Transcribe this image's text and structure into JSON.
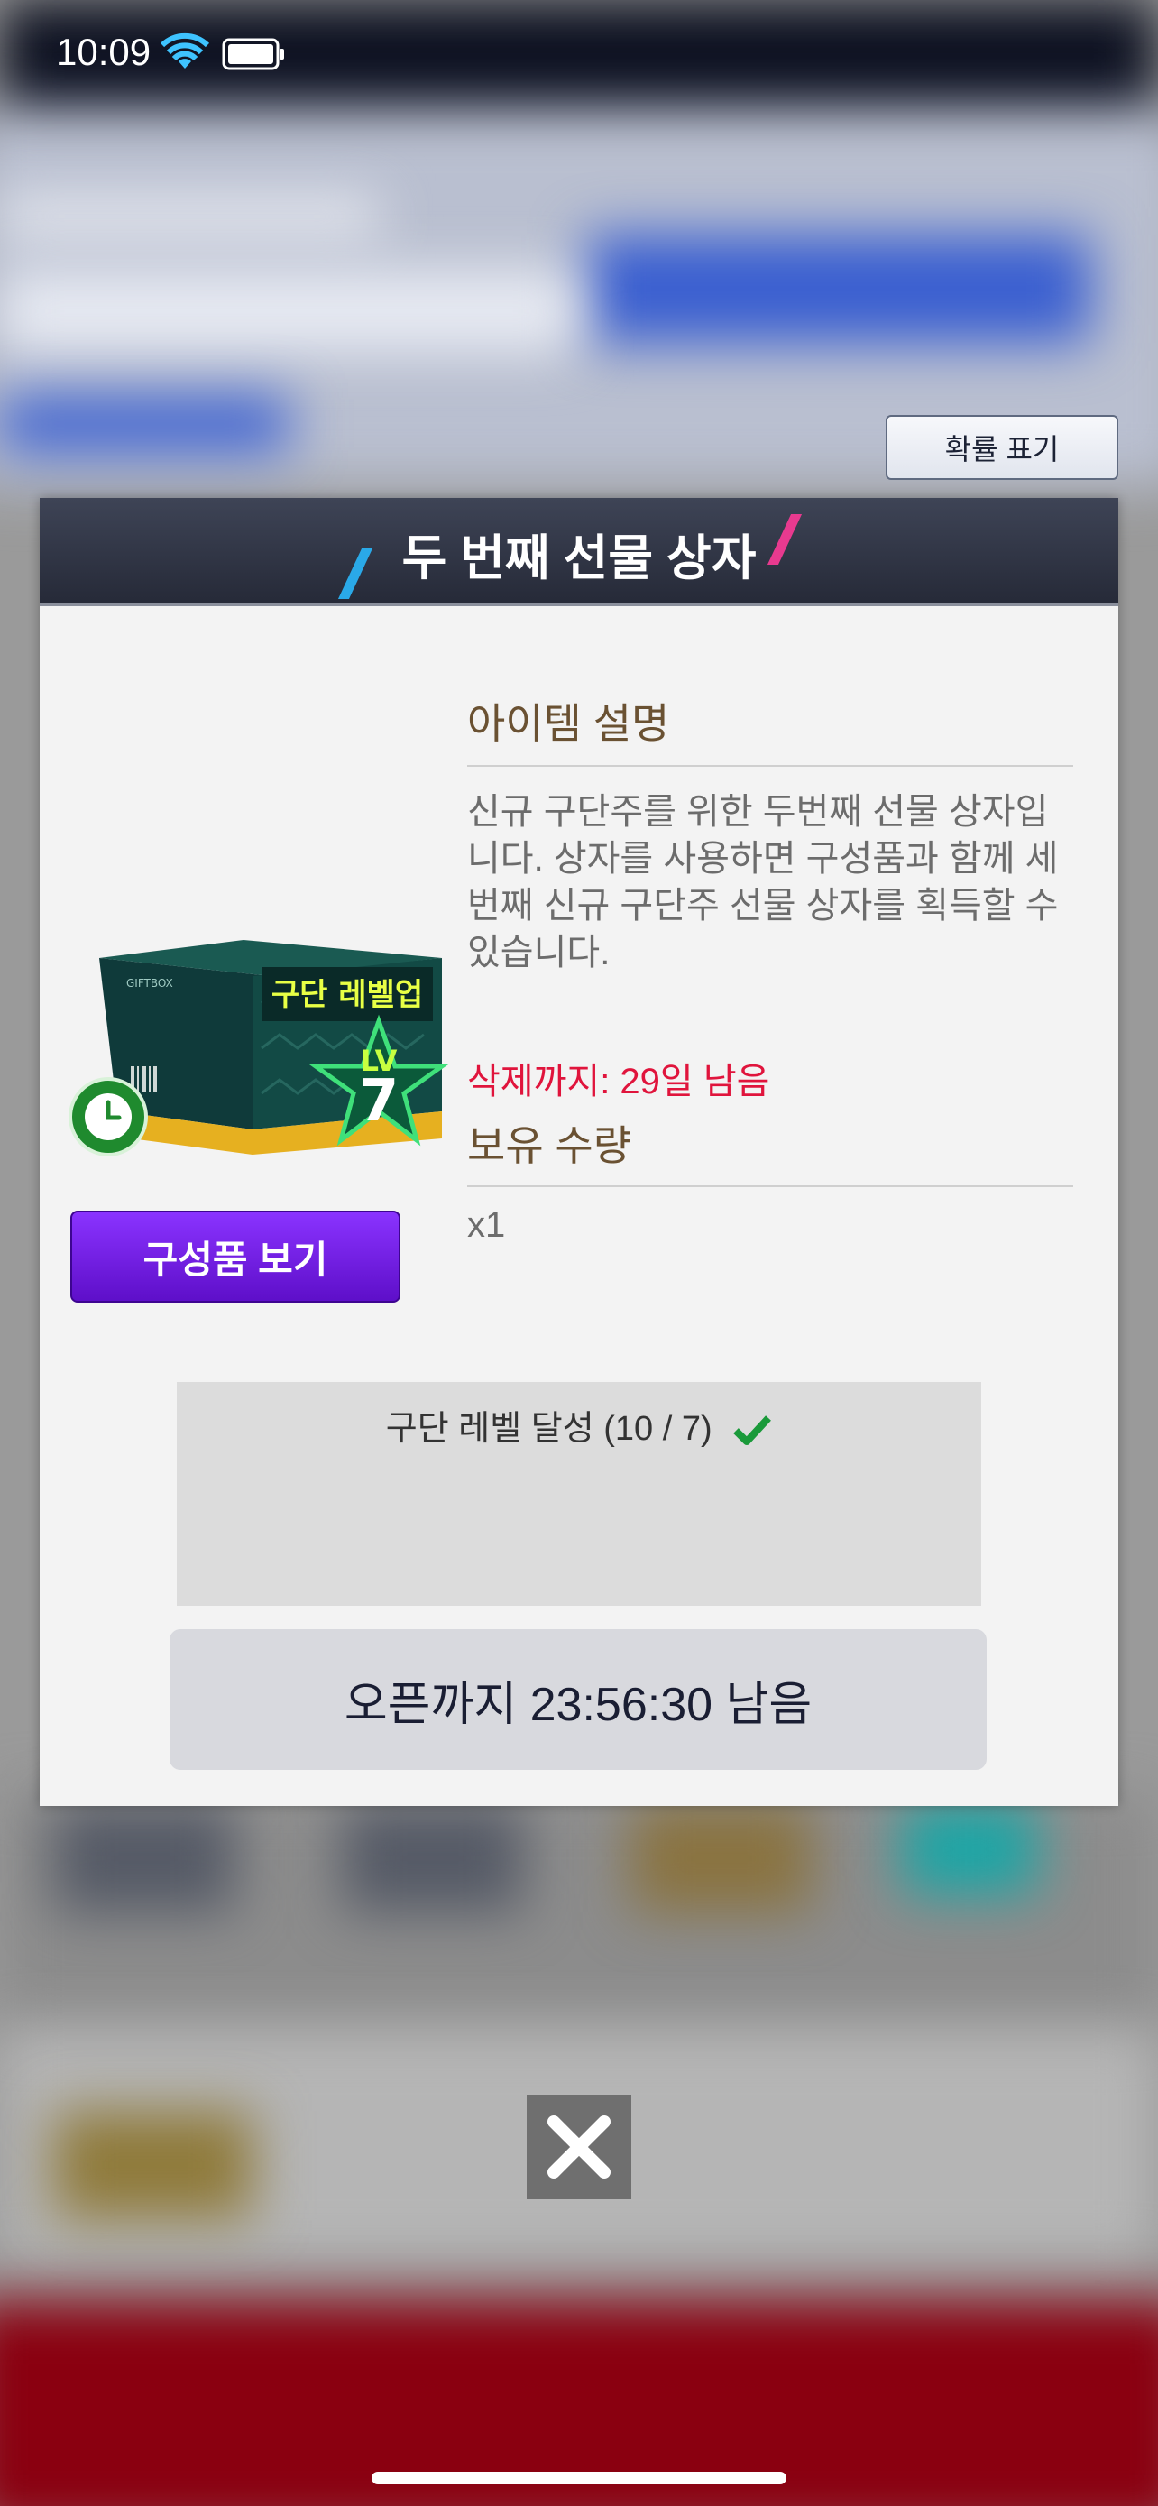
{
  "status_bar": {
    "time": "10:09"
  },
  "dialog": {
    "probability_button": "확률 표기",
    "title": "두 번째 선물 상자",
    "item_description_heading": "아이템 설명",
    "description": "신규 구단주를 위한 두번째 선물 상자입니다. 상자를 사용하면 구성품과 함께 세번째 신규 구단주 선물 상자를 획득할 수 있습니다.",
    "expiry": "삭제까지: 29일 남음",
    "quantity_heading": "보유 수량",
    "quantity": "x1",
    "components_button": "구성품 보기",
    "condition": "구단 레벨 달성 (10 / 7)",
    "open_timer_button": "오픈까지 23:56:30 남음",
    "item_image": {
      "box_label": "구단 레벨업",
      "brand": "GIFTBOX",
      "level_text": "LV",
      "level_number": "7"
    }
  },
  "colors": {
    "title_bar": "#2f3444",
    "expiry": "#e0143c",
    "components_button": "#7422f0",
    "heading": "#6a5132"
  }
}
